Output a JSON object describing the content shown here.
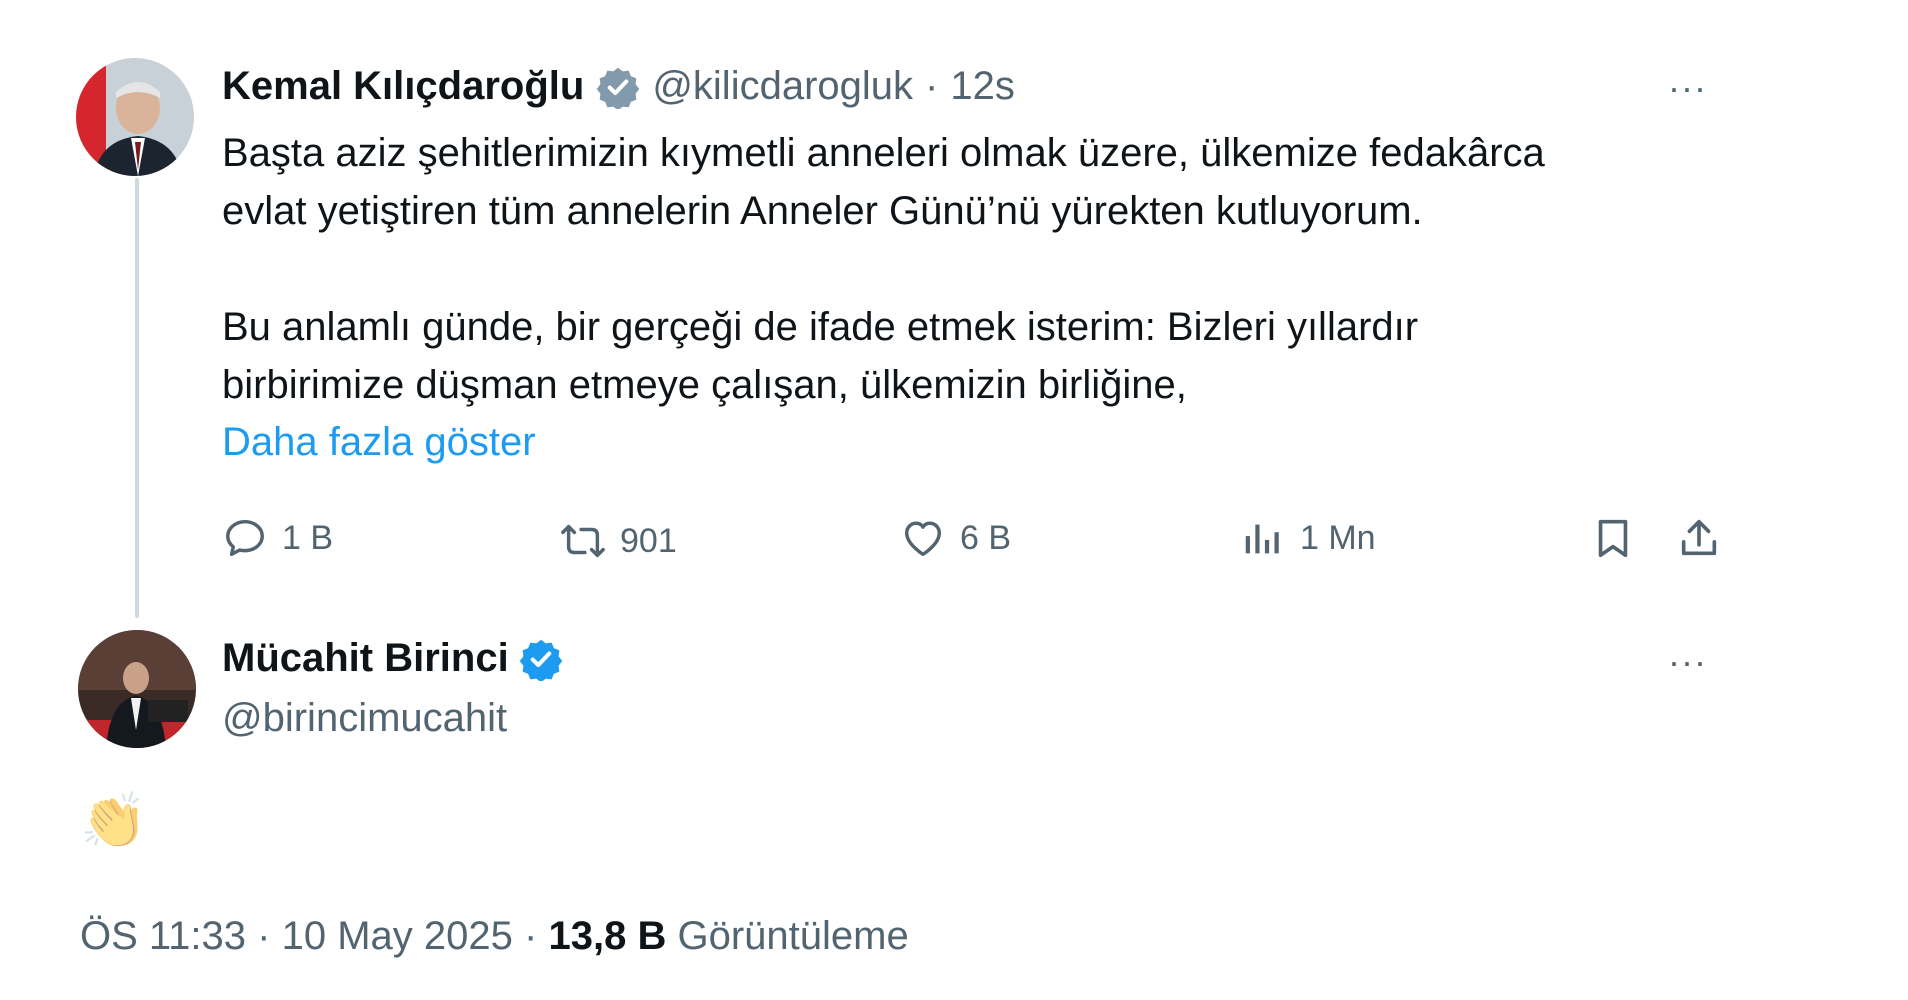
{
  "quoted_tweet": {
    "author_name": "Kemal Kılıçdaroğlu",
    "author_handle": "@kilicdarogluk",
    "separator": "·",
    "time_ago": "12s",
    "paragraph1_line1": "Başta aziz şehitlerimizin kıymetli anneleri olmak üzere, ülkemize fedakârca",
    "paragraph1_line2": "evlat yetiştiren tüm annelerin Anneler Günü’nü yürekten kutluyorum.",
    "paragraph2_line1": "Bu anlamlı günde, bir gerçeği de ifade etmek isterim: Bizleri yıllardır",
    "paragraph2_line2": "birbirimize düşman etmeye çalışan, ülkemizin birliğine,",
    "show_more": "Daha fazla göster",
    "more_menu": "···",
    "actions": {
      "replies": "1 B",
      "reposts": "901",
      "likes": "6 B",
      "views": "1 Mn"
    },
    "verified_color": "#829aab",
    "icons": [
      "reply-icon",
      "repost-icon",
      "like-icon",
      "views-icon",
      "bookmark-icon",
      "share-icon"
    ]
  },
  "reply_tweet": {
    "author_name": "Mücahit Birinci",
    "author_handle": "@birincimucahit",
    "more_menu": "···",
    "content_emoji": "👏",
    "verified_color": "#1d9bf0",
    "timestamp": "ÖS 11:33",
    "separator": "·",
    "date": "10 May 2025",
    "views_count": "13,8 B",
    "views_label": "Görüntüleme"
  }
}
